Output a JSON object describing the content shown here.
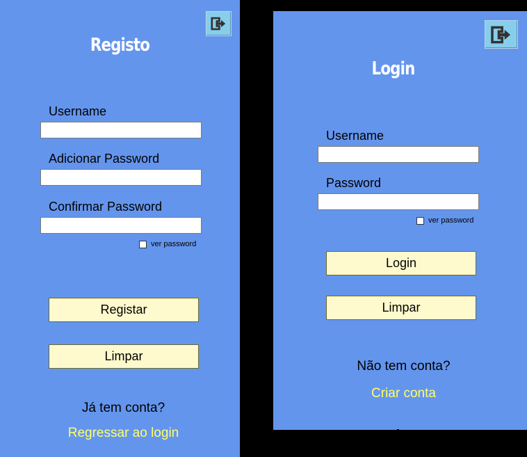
{
  "registo": {
    "title": "Registo",
    "username_label": "Username",
    "username_value": "",
    "add_password_label": "Adicionar Password",
    "add_password_value": "",
    "confirm_password_label": "Confirmar Password",
    "confirm_password_value": "",
    "show_password_label": "ver password",
    "register_button": "Registar",
    "clear_button": "Limpar",
    "have_account_text": "Já tem conta?",
    "back_to_login_link": "Regressar ao login"
  },
  "login": {
    "title": "Login",
    "username_label": "Username",
    "username_value": "",
    "password_label": "Password",
    "password_value": "",
    "show_password_label": "ver password",
    "login_button": "Login",
    "clear_button": "Limpar",
    "no_account_text": "Não tem conta?",
    "create_account_link": "Criar conta"
  },
  "colors": {
    "panel_bg": "#6495ED",
    "button_bg": "#FFFACD",
    "link": "#FFFF66",
    "exit_button_bg": "#87CEEB"
  },
  "icons": [
    "exit-icon"
  ]
}
